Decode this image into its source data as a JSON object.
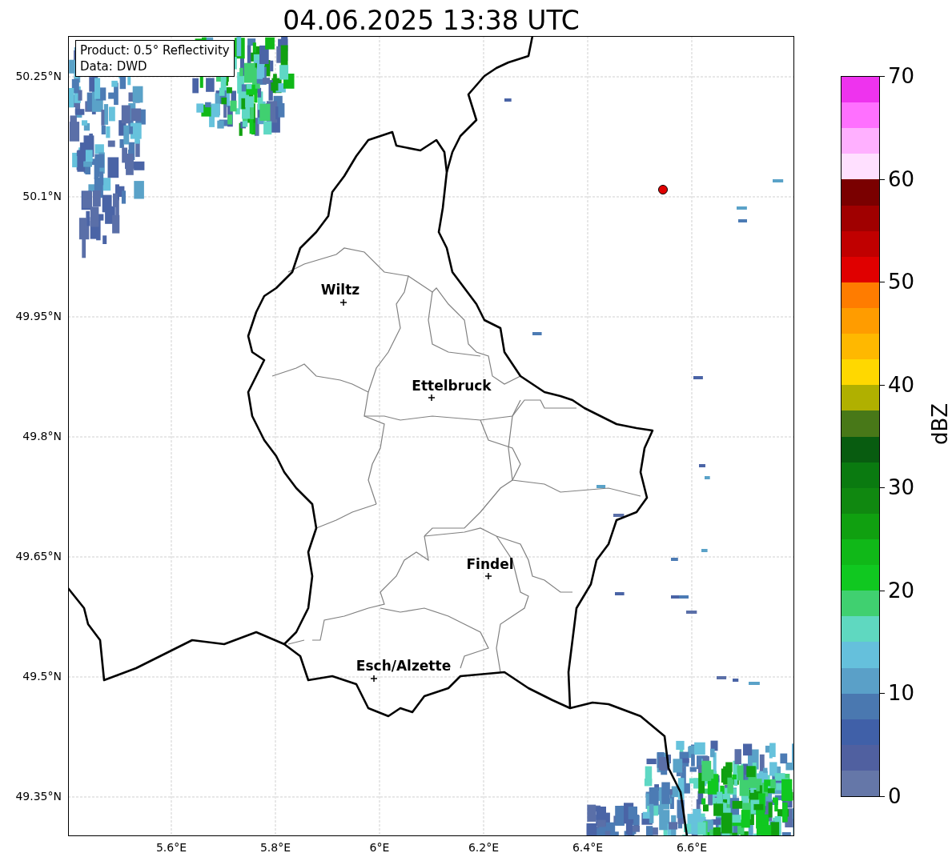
{
  "title": "04.06.2025 13:38 UTC",
  "info_box": [
    "Product: 0.5° Reflectivity",
    "Data: DWD"
  ],
  "map": {
    "y_ticks": [
      "50.25°N",
      "50.1°N",
      "49.95°N",
      "49.8°N",
      "49.65°N",
      "49.5°N",
      "49.35°N"
    ],
    "x_ticks": [
      "5.6°E",
      "5.8°E",
      "6°E",
      "6.2°E",
      "6.4°E",
      "6.6°E"
    ],
    "places": [
      {
        "name": "Wiltz"
      },
      {
        "name": "Ettelbruck"
      },
      {
        "name": "Findel"
      },
      {
        "name": "Esch/Alzette"
      }
    ]
  },
  "colorbar": {
    "label": "dBZ",
    "ticks": [
      "70",
      "60",
      "50",
      "40",
      "30",
      "20",
      "10",
      "0"
    ]
  }
}
